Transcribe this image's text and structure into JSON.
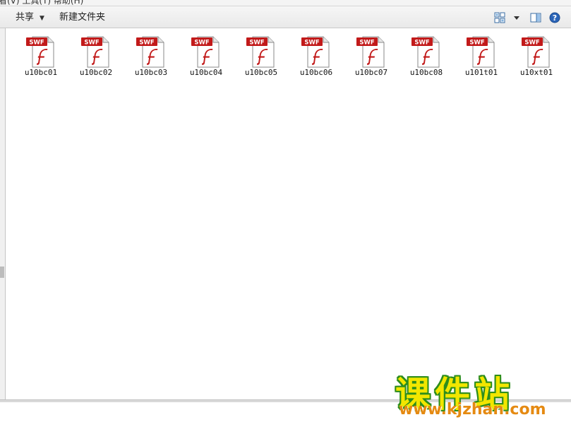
{
  "menu_fragment": {
    "text": "看(V)    工具(T)    帮助(H)"
  },
  "toolbar": {
    "share_label": "共享",
    "new_folder_label": "新建文件夹",
    "accent_color": "#1e5fb4"
  },
  "files": [
    {
      "name": "u10bc01",
      "badge": "SWF",
      "icon": "flash-swf-icon"
    },
    {
      "name": "u10bc02",
      "badge": "SWF",
      "icon": "flash-swf-icon"
    },
    {
      "name": "u10bc03",
      "badge": "SWF",
      "icon": "flash-swf-icon"
    },
    {
      "name": "u10bc04",
      "badge": "SWF",
      "icon": "flash-swf-icon"
    },
    {
      "name": "u10bc05",
      "badge": "SWF",
      "icon": "flash-swf-icon"
    },
    {
      "name": "u10bc06",
      "badge": "SWF",
      "icon": "flash-swf-icon"
    },
    {
      "name": "u10bc07",
      "badge": "SWF",
      "icon": "flash-swf-icon"
    },
    {
      "name": "u10bc08",
      "badge": "SWF",
      "icon": "flash-swf-icon"
    },
    {
      "name": "u101t01",
      "badge": "SWF",
      "icon": "flash-swf-icon"
    },
    {
      "name": "u10xt01",
      "badge": "SWF",
      "icon": "flash-swf-icon"
    }
  ],
  "watermark": {
    "title": "课件站",
    "url": "www.kjzhan.com",
    "title_color": "#f2e600",
    "url_color": "#e58a12"
  }
}
